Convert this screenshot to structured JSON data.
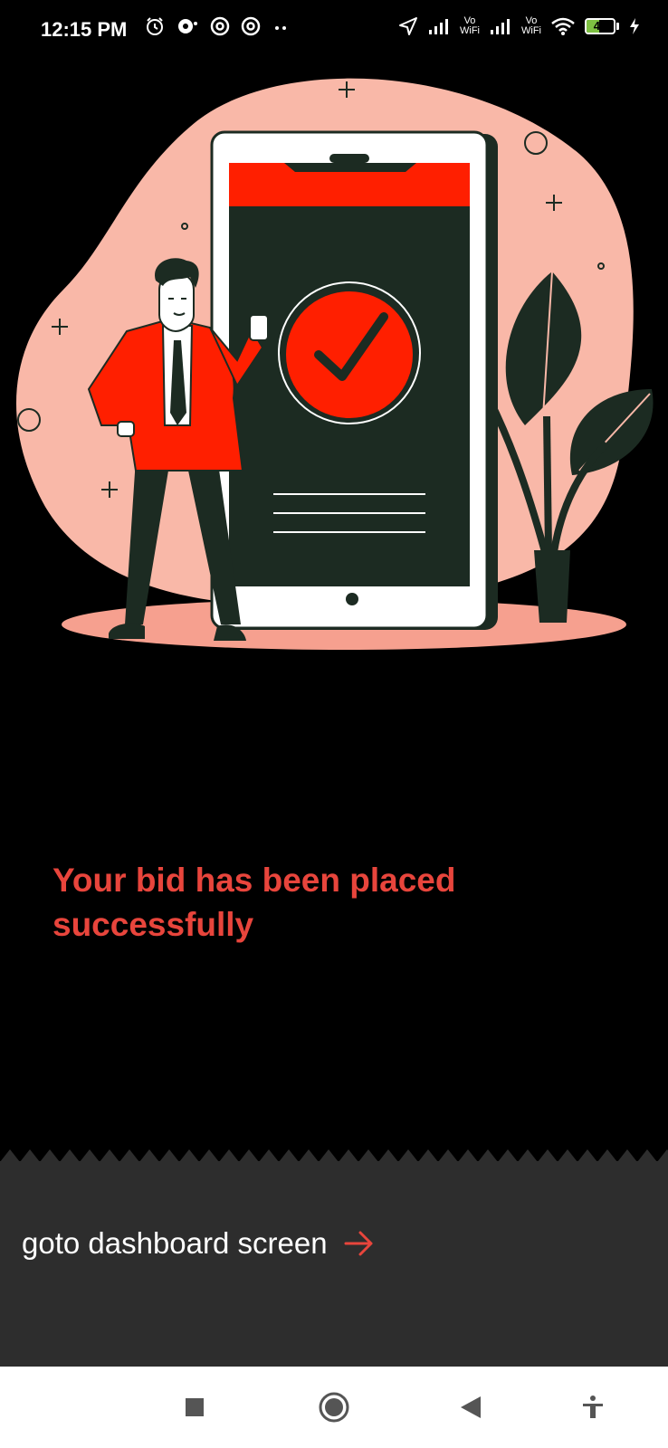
{
  "status_bar": {
    "time": "12:15 PM",
    "network_label_1": "Vo\nWiFi",
    "network_label_2": "Vo\nWiFi",
    "battery_level": "45",
    "battery_fraction": 0.45,
    "left_icons": [
      "alarm-icon",
      "notification-icon",
      "app-icon",
      "app-icon",
      "more-dots-icon"
    ],
    "right_icons": [
      "location-icon",
      "signal-icon",
      "signal-icon",
      "wifi-icon",
      "battery-icon",
      "charging-icon"
    ]
  },
  "main": {
    "success_message": "Your bid has been placed successfully"
  },
  "footer": {
    "goto_label": "goto dashboard screen",
    "goto_icon": "arrow-right-icon"
  },
  "nav_bar": {
    "buttons": [
      "recents-icon",
      "home-icon",
      "back-icon",
      "accessibility-icon"
    ]
  },
  "colors": {
    "accent": "#e8453c",
    "illustration_red": "#ff1f00",
    "illustration_pink": "#f9b8a8",
    "dark_green": "#1c2b22",
    "panel": "#2d2d2d"
  }
}
